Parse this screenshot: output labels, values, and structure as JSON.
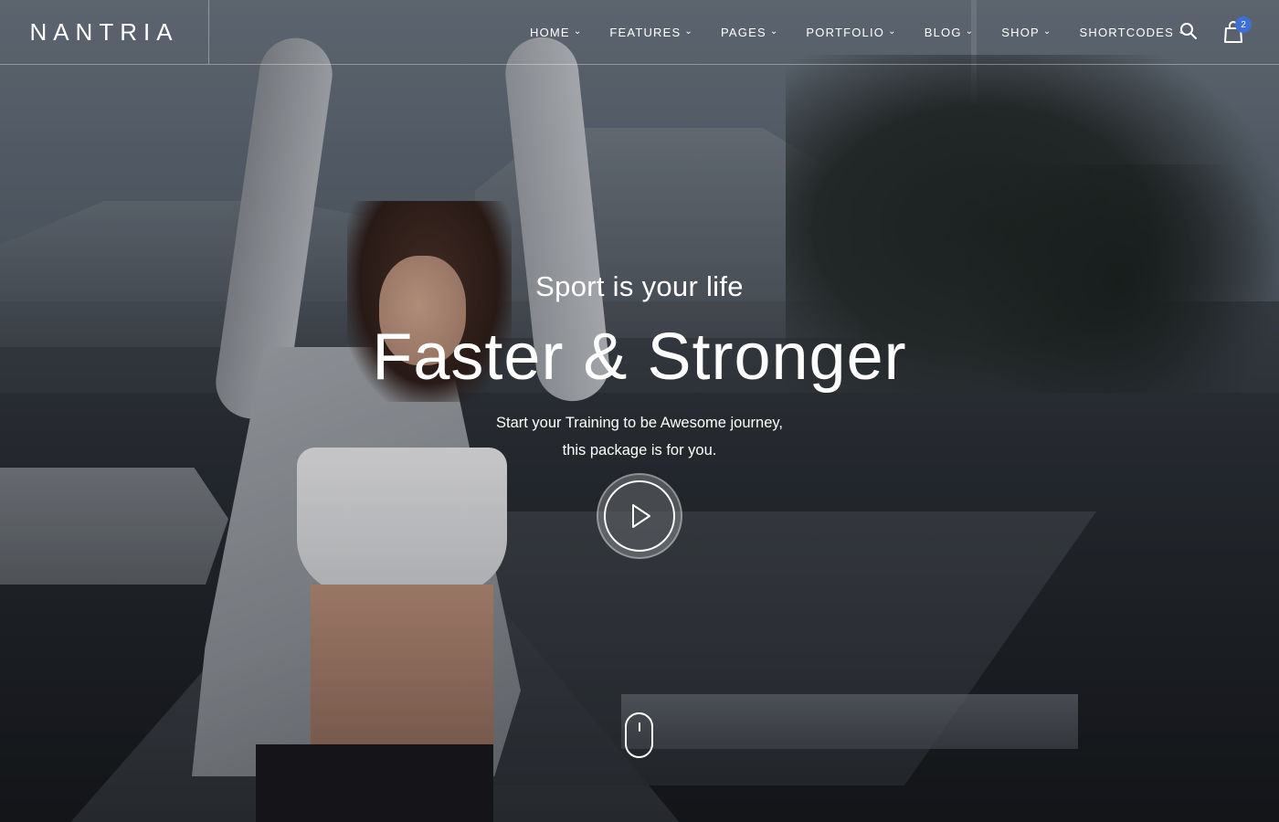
{
  "brand": {
    "logo_text": "NANTRIA"
  },
  "nav": {
    "items": [
      {
        "label": "HOME"
      },
      {
        "label": "FEATURES"
      },
      {
        "label": "PAGES"
      },
      {
        "label": "PORTFOLIO"
      },
      {
        "label": "BLOG"
      },
      {
        "label": "SHOP"
      },
      {
        "label": "SHORTCODES"
      }
    ],
    "dropdown_icon": "chevron-down-icon",
    "search_icon": "search-icon",
    "cart_icon": "shopping-bag-icon",
    "cart_count": "2"
  },
  "hero": {
    "subtitle": "Sport is your life",
    "title": "Faster & Stronger",
    "description_line1": "Start your Training to be Awesome journey,",
    "description_line2": "this package is for you.",
    "play_icon": "play-icon",
    "scroll_icon": "mouse-scroll-icon"
  },
  "colors": {
    "text": "#ffffff",
    "badge": "#3d6fd6",
    "divider": "rgba(255,255,255,0.35)"
  }
}
